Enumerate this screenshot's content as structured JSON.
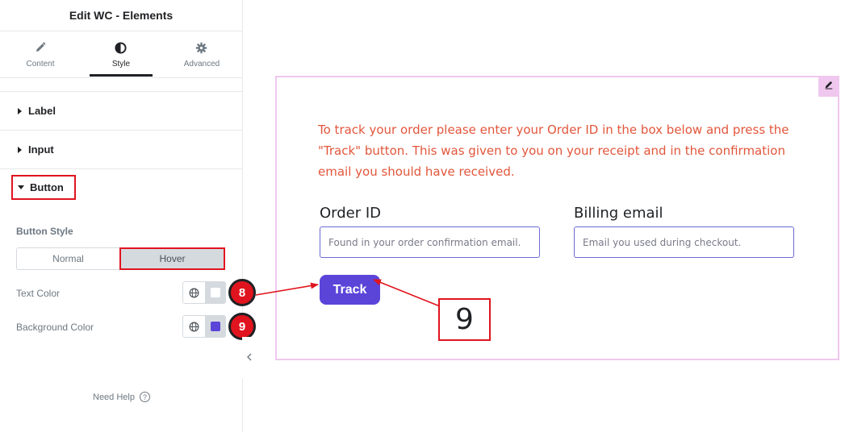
{
  "panel": {
    "title": "Edit WC - Elements",
    "tabs": [
      {
        "label": "Content",
        "icon": "pencil-icon"
      },
      {
        "label": "Style",
        "icon": "half-circle-icon"
      },
      {
        "label": "Advanced",
        "icon": "gear-icon"
      }
    ],
    "active_tab": "Style",
    "sections": [
      {
        "label": "Label",
        "expanded": false
      },
      {
        "label": "Input",
        "expanded": false
      },
      {
        "label": "Button",
        "expanded": true
      }
    ],
    "button_style_label": "Button Style",
    "toggle": {
      "normal": "Normal",
      "hover": "Hover",
      "selected": "Hover"
    },
    "text_color_label": "Text Color",
    "text_color_value": "#ffffff",
    "background_color_label": "Background Color",
    "background_color_value": "#5b45d9",
    "need_help": "Need Help"
  },
  "annotations": {
    "badge_text_color": "8",
    "badge_background_color": "9",
    "callout_number": "9"
  },
  "preview": {
    "notice": "To track your order please enter your Order ID in the box below and press the \"Track\" button. This was given to you on your receipt and in the confirmation email you should have received.",
    "order_id_label": "Order ID",
    "order_id_placeholder": "Found in your order confirmation email.",
    "billing_email_label": "Billing email",
    "billing_email_placeholder": "Email you used during checkout.",
    "track_button": "Track"
  },
  "colors": {
    "accent_red": "#e0141e",
    "notice_text": "#e2563b",
    "button_bg": "#5b45d9",
    "preview_border": "#f0c7ef"
  }
}
